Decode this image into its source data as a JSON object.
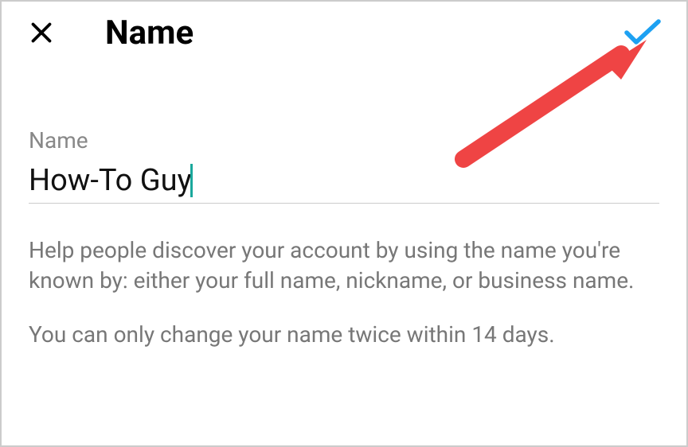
{
  "header": {
    "title": "Name"
  },
  "form": {
    "name_label": "Name",
    "name_value": "How-To Guy"
  },
  "help": {
    "paragraph1": "Help people discover your account by using the name you're known by: either your full name, nickname, or business name.",
    "paragraph2": "You can only change your name twice within 14 days."
  }
}
